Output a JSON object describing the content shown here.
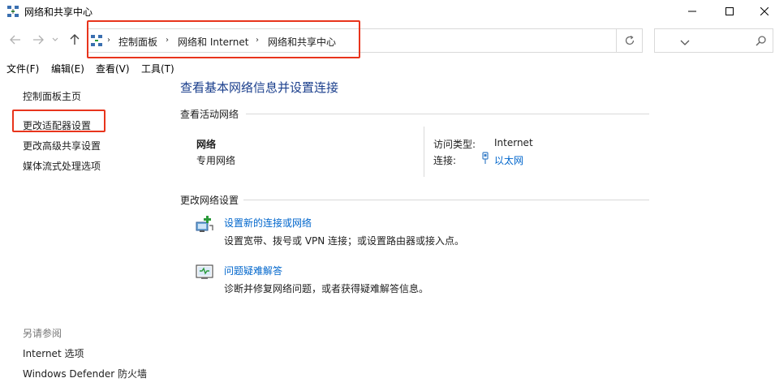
{
  "window": {
    "title": "网络和共享中心"
  },
  "nav": {
    "breadcrumbs": [
      "控制面板",
      "网络和 Internet",
      "网络和共享中心"
    ],
    "search_placeholder": ""
  },
  "menu": [
    "文件(F)",
    "编辑(E)",
    "查看(V)",
    "工具(T)"
  ],
  "left_pane": {
    "links": [
      "控制面板主页",
      "更改适配器设置",
      "更改高级共享设置",
      "媒体流式处理选项"
    ],
    "see_also_header": "另请参阅",
    "see_also_links": [
      "Internet 选项",
      "Windows Defender 防火墙"
    ]
  },
  "main": {
    "title": "查看基本网络信息并设置连接",
    "active_networks_label": "查看活动网络",
    "network": {
      "name": "网络",
      "type": "专用网络",
      "access_type_label": "访问类型:",
      "access_type_value": "Internet",
      "connection_label": "连接:",
      "connection_value": "以太网"
    },
    "change_settings_label": "更改网络设置",
    "tasks": [
      {
        "link": "设置新的连接或网络",
        "desc": "设置宽带、拨号或 VPN 连接；或设置路由器或接入点。"
      },
      {
        "link": "问题疑难解答",
        "desc": "诊断并修复网络问题，或者获得疑难解答信息。"
      }
    ]
  },
  "colors": {
    "title_blue": "#1a3e8c",
    "link_blue": "#0066cc",
    "highlight_red": "#e8341c",
    "separator": "#d9d9d9"
  }
}
